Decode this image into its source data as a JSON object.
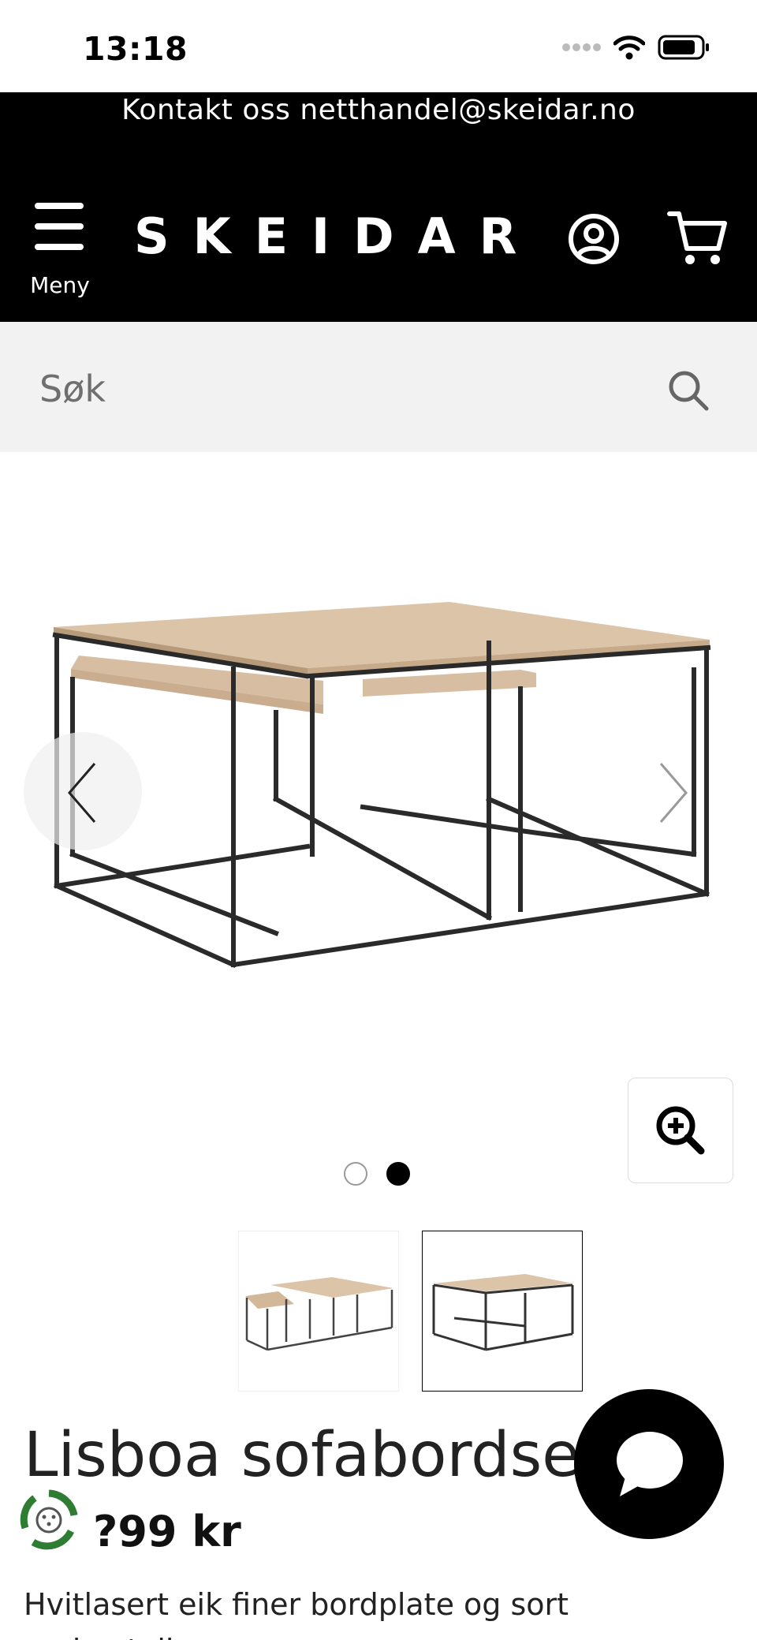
{
  "status_bar": {
    "time": "13:18",
    "icons": [
      "signal-dots-icon",
      "wifi-icon",
      "battery-icon"
    ]
  },
  "contact_banner": {
    "text": "Kontakt oss netthandel@skeidar.no"
  },
  "header": {
    "menu_label": "Meny",
    "logo_text": "SKEIDAR",
    "icons": [
      "hamburger-icon",
      "account-icon",
      "cart-icon"
    ]
  },
  "search": {
    "placeholder": "Søk",
    "icon": "search-icon"
  },
  "gallery": {
    "image_alt": "Lisboa sofabordsett",
    "nav_icons": [
      "chevron-left-icon",
      "chevron-right-icon"
    ],
    "zoom_icon": "zoom-in-icon",
    "dots_total": 2,
    "active_dot": 2,
    "thumbnails_count": 2,
    "active_thumbnail": 2
  },
  "product": {
    "title": "Lisboa sofabordsett",
    "price": "?99 kr",
    "description": "Hvitlasert eik finer bordplate og sort understell"
  },
  "colors": {
    "header_bg": "#000000",
    "search_bg": "#f2f2f2",
    "wood": "#dcc4a8",
    "frame": "#2a2a2a",
    "eco_green": "#2e7d32"
  }
}
